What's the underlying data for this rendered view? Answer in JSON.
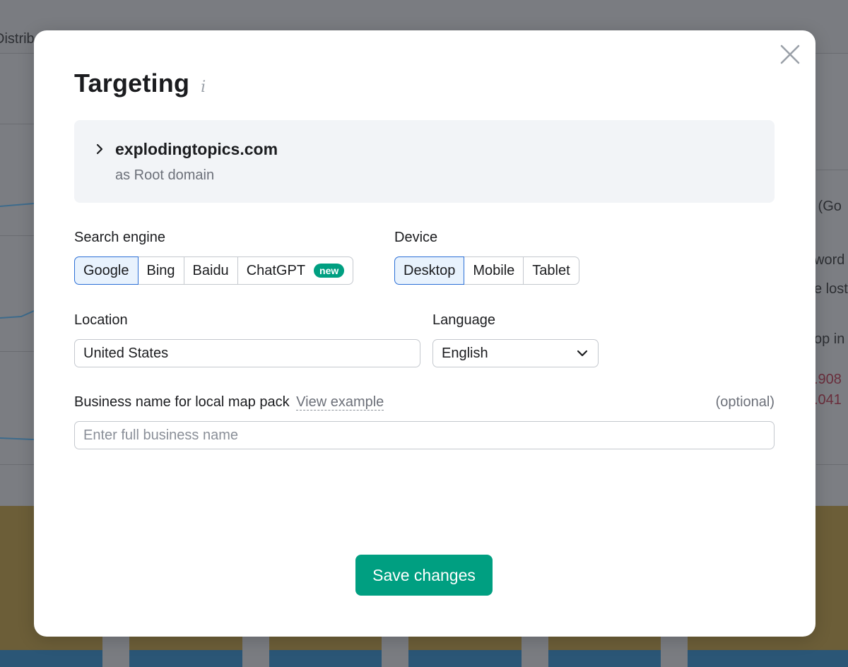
{
  "background": {
    "fragments": [
      "Distrib",
      "s (Go",
      "word",
      "e lost",
      "op in",
      ".908",
      ".041"
    ]
  },
  "modal": {
    "title": "Targeting",
    "info_icon": "info-icon",
    "close_icon": "close-icon",
    "domain": {
      "name": "explodingtopics.com",
      "scope": "as Root domain"
    },
    "search_engine": {
      "label": "Search engine",
      "options": [
        "Google",
        "Bing",
        "Baidu",
        "ChatGPT"
      ],
      "selected": "Google",
      "new_badge": "new"
    },
    "device": {
      "label": "Device",
      "options": [
        "Desktop",
        "Mobile",
        "Tablet"
      ],
      "selected": "Desktop"
    },
    "location": {
      "label": "Location",
      "value": "United States"
    },
    "language": {
      "label": "Language",
      "value": "English"
    },
    "business": {
      "label": "Business name for local map pack",
      "link": "View example",
      "optional": "(optional)",
      "placeholder": "Enter full business name"
    },
    "save_label": "Save changes"
  },
  "colors": {
    "accent": "#009f81",
    "selected_border": "#2b6fd6",
    "selected_fill": "#e8f2fd"
  }
}
